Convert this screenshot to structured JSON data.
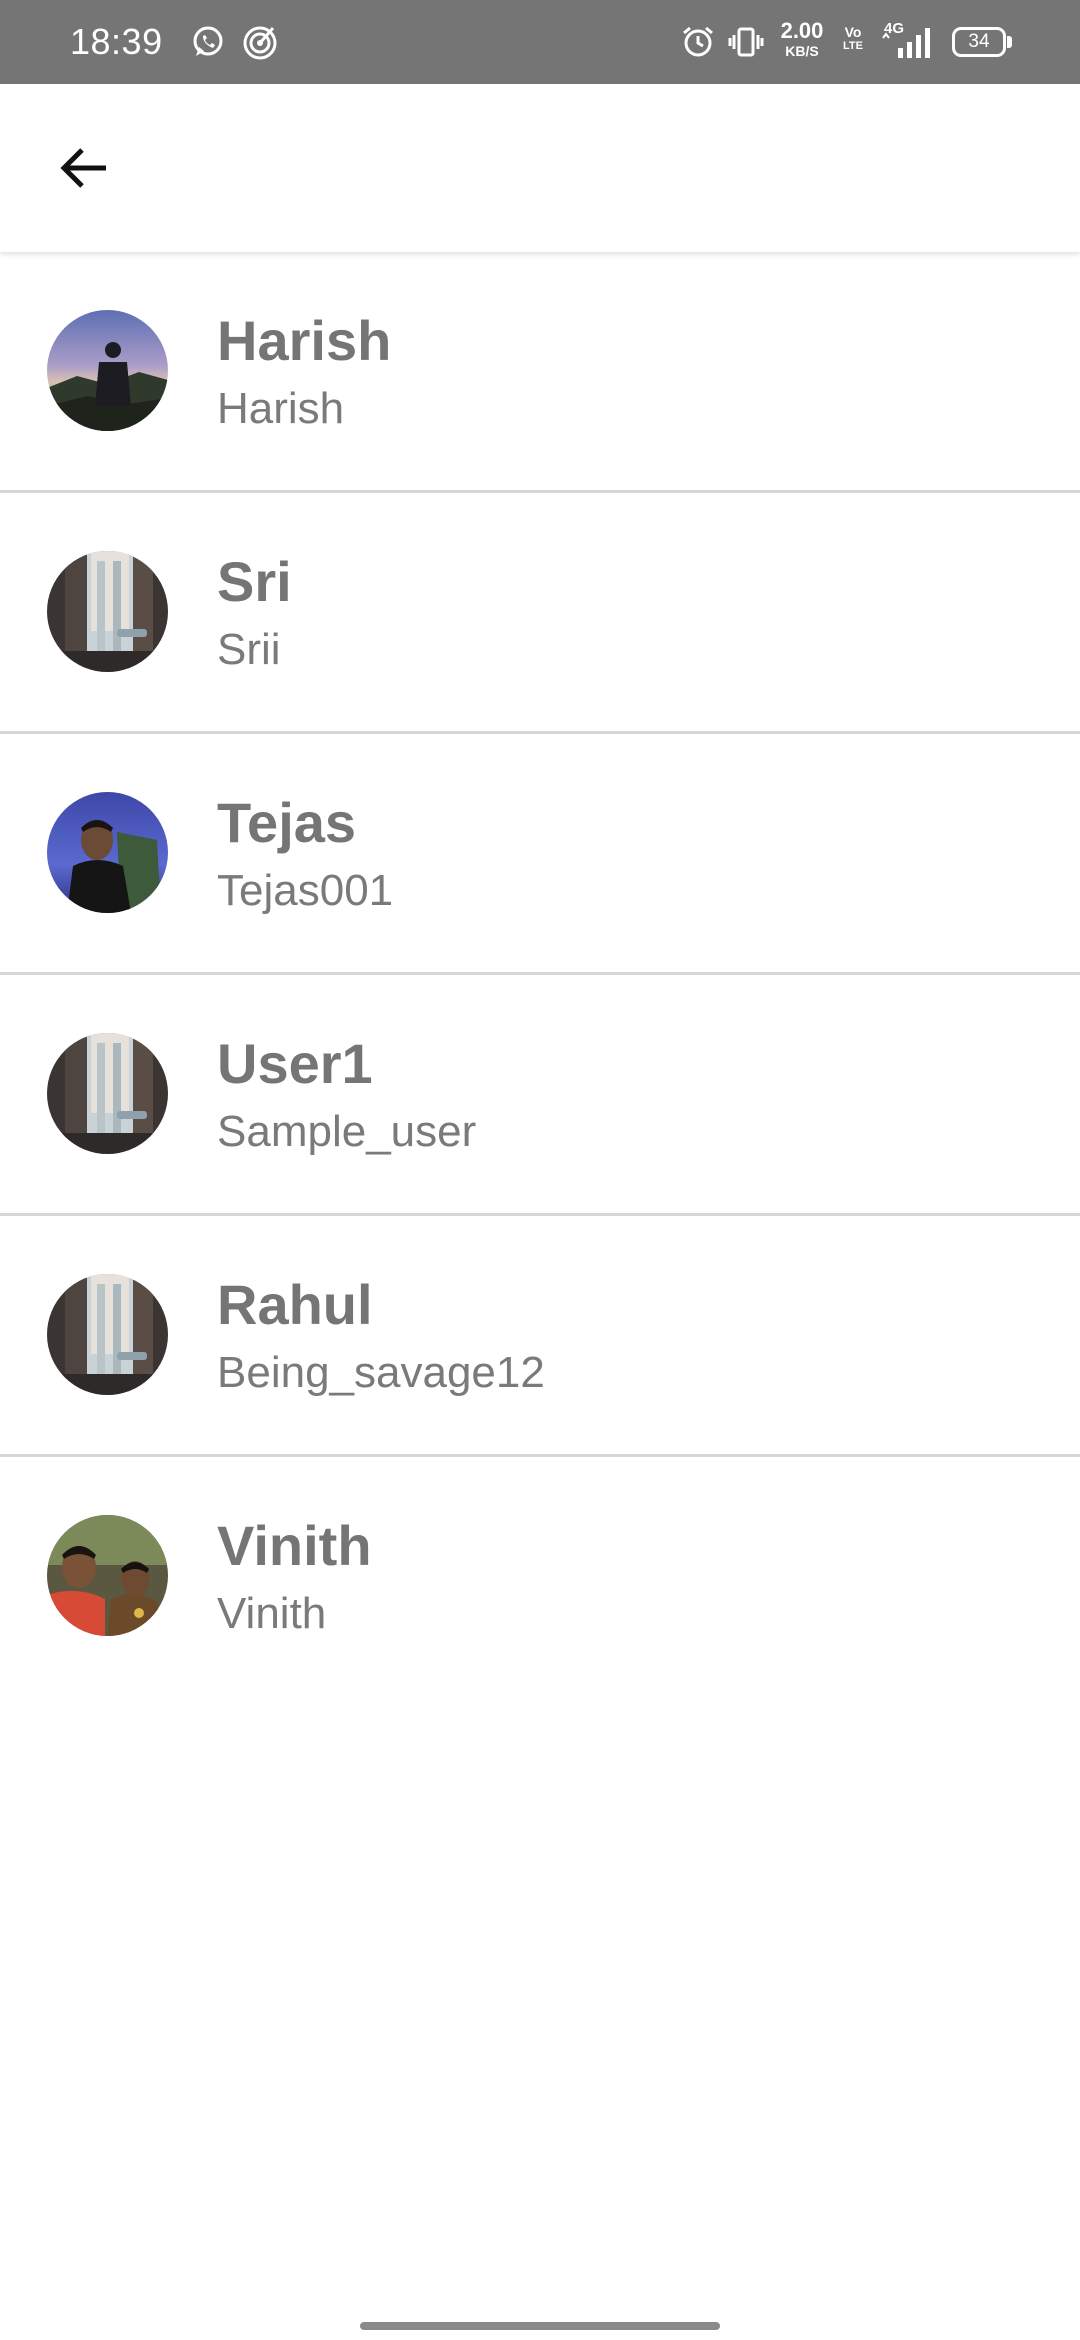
{
  "status_bar": {
    "time": "18:39",
    "network_speed_value": "2.00",
    "network_speed_unit": "KB/S",
    "volte_top": "Vo",
    "volte_bottom": "LTE",
    "network_type": "4G",
    "battery_level": "34",
    "icons": [
      "whatsapp-icon",
      "radar-icon",
      "alarm-icon",
      "vibrate-icon",
      "signal-icon",
      "battery-icon"
    ]
  },
  "app_bar": {
    "back_icon": "arrow-back-icon"
  },
  "users": [
    {
      "name": "Harish",
      "username": "Harish",
      "avatar": "landscape-photo"
    },
    {
      "name": "Sri",
      "username": "Srii",
      "avatar": "window-photo"
    },
    {
      "name": "Tejas",
      "username": "Tejas001",
      "avatar": "portrait-photo"
    },
    {
      "name": "User1",
      "username": "Sample_user",
      "avatar": "window-photo"
    },
    {
      "name": "Rahul",
      "username": "Being_savage12",
      "avatar": "window-photo"
    },
    {
      "name": "Vinith",
      "username": "Vinith",
      "avatar": "group-photo"
    }
  ],
  "colors": {
    "status_bar_bg": "#757575",
    "text_gray": "#757575",
    "divider": "#d6d6d6",
    "background": "#ffffff"
  }
}
